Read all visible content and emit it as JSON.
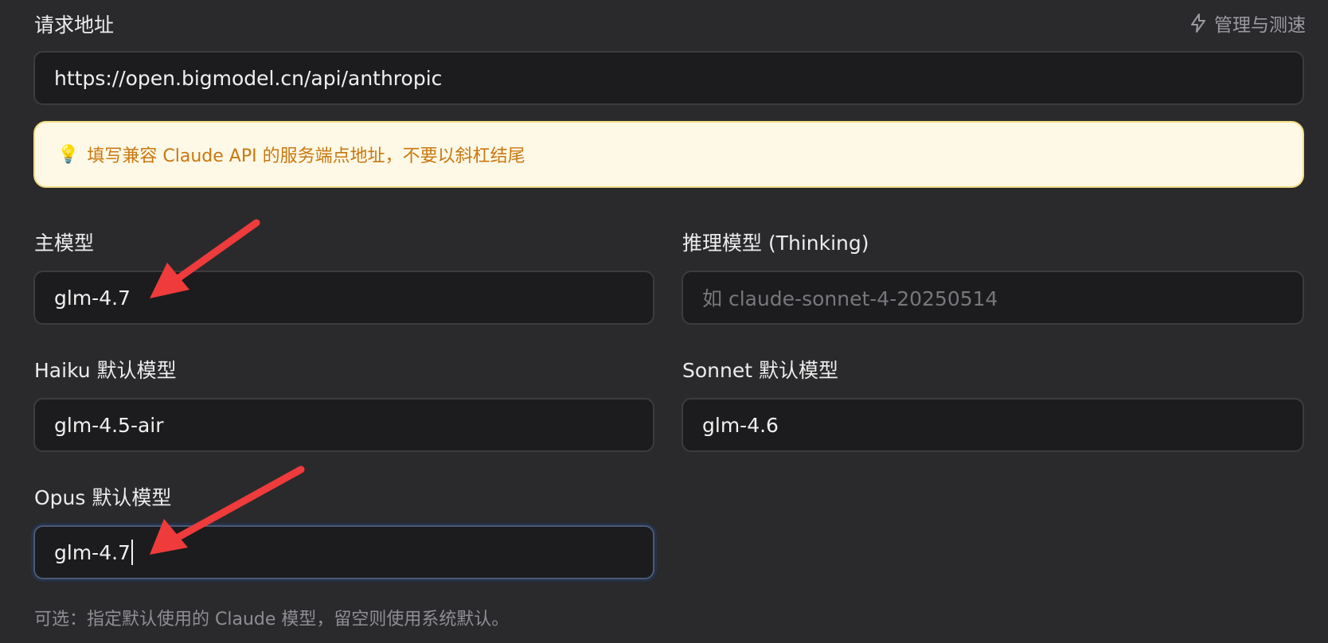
{
  "endpoint": {
    "label": "请求地址",
    "value": "https://open.bigmodel.cn/api/anthropic",
    "manage_label": "管理与测速"
  },
  "tip": {
    "icon": "lightbulb-icon",
    "text": "填写兼容 Claude API 的服务端点地址，不要以斜杠结尾"
  },
  "models": {
    "main": {
      "label": "主模型",
      "value": "glm-4.7"
    },
    "thinking": {
      "label": "推理模型 (Thinking)",
      "placeholder": "如 claude-sonnet-4-20250514"
    },
    "haiku": {
      "label": "Haiku 默认模型",
      "value": "glm-4.5-air"
    },
    "sonnet": {
      "label": "Sonnet 默认模型",
      "value": "glm-4.6"
    },
    "opus": {
      "label": "Opus 默认模型",
      "value": "glm-4.7"
    }
  },
  "hint": "可选：指定默认使用的 Claude 模型，留空则使用系统默认。",
  "colors": {
    "background": "#2a2a2d",
    "field_bg": "#1c1c1e",
    "tip_bg": "#fef9e6",
    "tip_text": "#c9770f",
    "annotation_arrow": "#ef3b3b"
  }
}
